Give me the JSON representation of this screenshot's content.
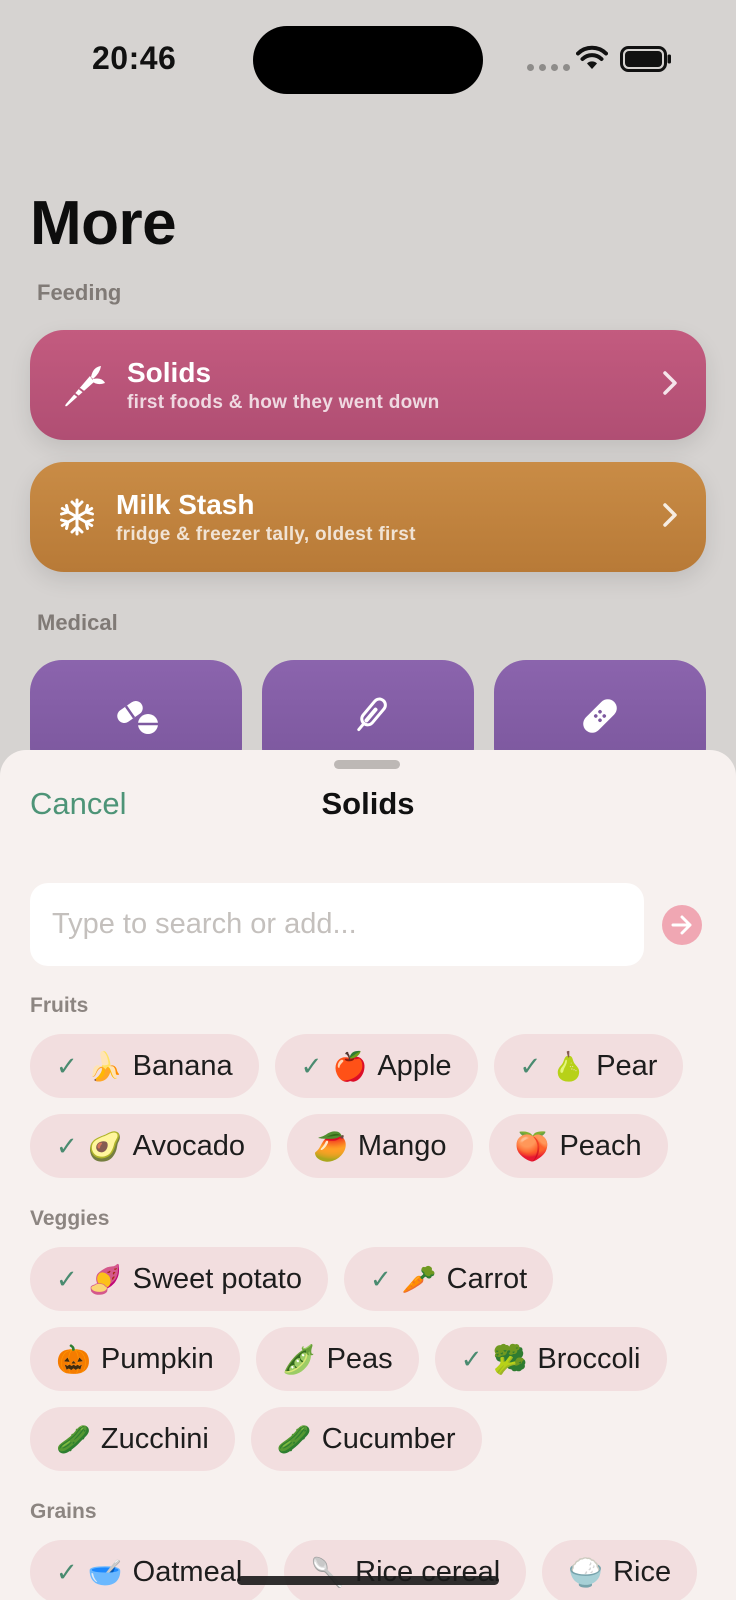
{
  "status": {
    "time": "20:46"
  },
  "page": {
    "title": "More",
    "sections": {
      "feeding": "Feeding",
      "medical": "Medical"
    },
    "cards": {
      "solids": {
        "title": "Solids",
        "subtitle": "first foods & how they went down",
        "icon": "carrot-icon",
        "color": "#b9557a"
      },
      "milk": {
        "title": "Milk Stash",
        "subtitle": "fridge & freezer tally, oldest first",
        "icon": "snowflake-icon",
        "color": "#c18440"
      }
    },
    "medical_tiles": [
      {
        "icon": "pills-icon"
      },
      {
        "icon": "thermometer-icon"
      },
      {
        "icon": "bandage-icon"
      }
    ]
  },
  "sheet": {
    "cancel_label": "Cancel",
    "title": "Solids",
    "search": {
      "placeholder": "Type to search or add...",
      "value": ""
    },
    "groups": {
      "fruits": {
        "label": "Fruits",
        "items": [
          {
            "name": "Banana",
            "emoji": "🍌",
            "checked": true
          },
          {
            "name": "Apple",
            "emoji": "🍎",
            "checked": true
          },
          {
            "name": "Pear",
            "emoji": "🍐",
            "checked": true
          },
          {
            "name": "Avocado",
            "emoji": "🥑",
            "checked": true
          },
          {
            "name": "Mango",
            "emoji": "🥭",
            "checked": false
          },
          {
            "name": "Peach",
            "emoji": "🍑",
            "checked": false
          }
        ]
      },
      "veggies": {
        "label": "Veggies",
        "items": [
          {
            "name": "Sweet potato",
            "emoji": "🍠",
            "checked": true
          },
          {
            "name": "Carrot",
            "emoji": "🥕",
            "checked": true
          },
          {
            "name": "Pumpkin",
            "emoji": "🎃",
            "checked": false
          },
          {
            "name": "Peas",
            "emoji": "🫛",
            "checked": false
          },
          {
            "name": "Broccoli",
            "emoji": "🥦",
            "checked": true
          },
          {
            "name": "Zucchini",
            "emoji": "🥒",
            "checked": false
          },
          {
            "name": "Cucumber",
            "emoji": "🥒",
            "checked": false
          }
        ]
      },
      "grains": {
        "label": "Grains",
        "items": [
          {
            "name": "Oatmeal",
            "emoji": "🥣",
            "checked": true
          },
          {
            "name": "Rice cereal",
            "emoji": "🥄",
            "checked": false
          },
          {
            "name": "Rice",
            "emoji": "🍚",
            "checked": false
          }
        ]
      }
    },
    "check_glyph": "✓",
    "accent_color": "#4d9477",
    "chip_color": "#f2dedf"
  }
}
